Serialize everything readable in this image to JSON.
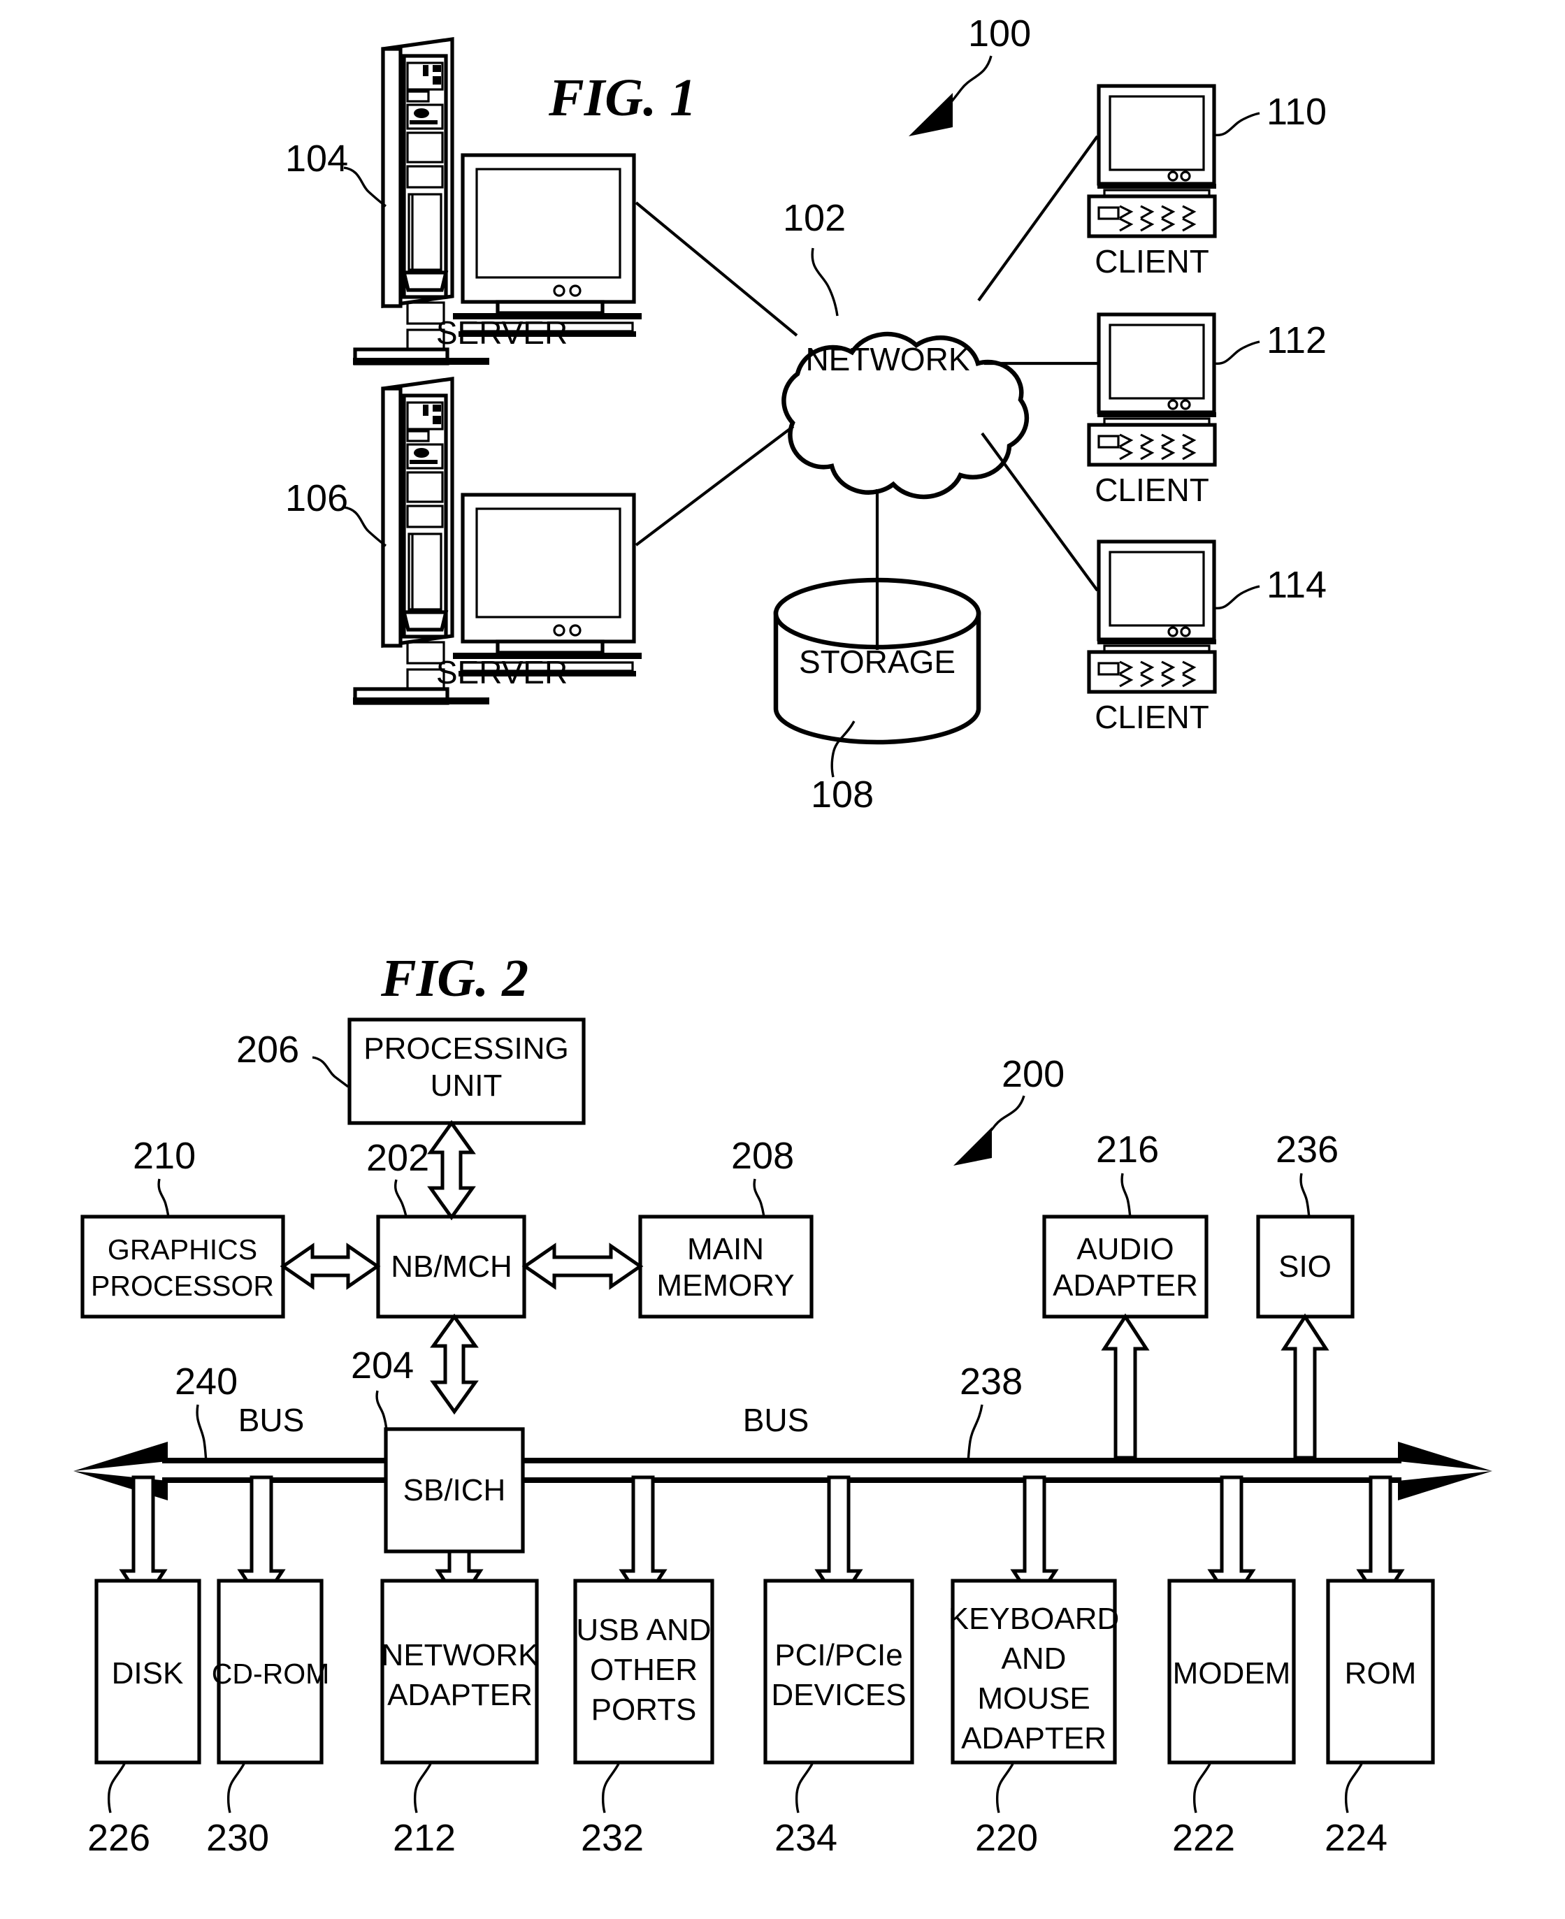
{
  "figures": [
    {
      "id": "fig1",
      "title": "FIG. 1",
      "system_ref": "100",
      "nodes": {
        "network": {
          "label": "NETWORK",
          "ref": "102"
        },
        "server_top": {
          "label": "SERVER",
          "ref": "104"
        },
        "server_bottom": {
          "label": "SERVER",
          "ref": "106"
        },
        "storage": {
          "label": "STORAGE",
          "ref": "108"
        },
        "client_1": {
          "label": "CLIENT",
          "ref": "110"
        },
        "client_2": {
          "label": "CLIENT",
          "ref": "112"
        },
        "client_3": {
          "label": "CLIENT",
          "ref": "114"
        }
      }
    },
    {
      "id": "fig2",
      "title": "FIG. 2",
      "system_ref": "200",
      "nodes": {
        "processing_unit": {
          "label_line1": "PROCESSING",
          "label_line2": "UNIT",
          "ref": "206"
        },
        "nb_mch": {
          "label": "NB/MCH",
          "ref": "202"
        },
        "graphics_processor": {
          "label_line1": "GRAPHICS",
          "label_line2": "PROCESSOR",
          "ref": "210"
        },
        "main_memory": {
          "label_line1": "MAIN",
          "label_line2": "MEMORY",
          "ref": "208"
        },
        "audio_adapter": {
          "label_line1": "AUDIO",
          "label_line2": "ADAPTER",
          "ref": "216"
        },
        "sio": {
          "label": "SIO",
          "ref": "236"
        },
        "sb_ich": {
          "label": "SB/ICH",
          "ref": "204"
        },
        "bus_left": {
          "label": "BUS",
          "ref": "240"
        },
        "bus_right": {
          "label": "BUS",
          "ref": "238"
        }
      },
      "peripherals": [
        {
          "name": "disk",
          "lines": [
            "DISK"
          ],
          "ref": "226"
        },
        {
          "name": "cd-rom",
          "lines": [
            "CD-ROM"
          ],
          "ref": "230"
        },
        {
          "name": "network-adapter",
          "lines": [
            "NETWORK",
            "ADAPTER"
          ],
          "ref": "212"
        },
        {
          "name": "usb-and-other-ports",
          "lines": [
            "USB AND",
            "OTHER",
            "PORTS"
          ],
          "ref": "232"
        },
        {
          "name": "pci-pcie-devices",
          "lines": [
            "PCI/PCIe",
            "DEVICES"
          ],
          "ref": "234"
        },
        {
          "name": "keyboard-and-mouse-adapter",
          "lines": [
            "KEYBOARD",
            "AND",
            "MOUSE",
            "ADAPTER"
          ],
          "ref": "220"
        },
        {
          "name": "modem",
          "lines": [
            "MODEM"
          ],
          "ref": "222"
        },
        {
          "name": "rom",
          "lines": [
            "ROM"
          ],
          "ref": "224"
        }
      ]
    }
  ],
  "colors": {
    "ink": "#000000",
    "paper": "#ffffff"
  }
}
